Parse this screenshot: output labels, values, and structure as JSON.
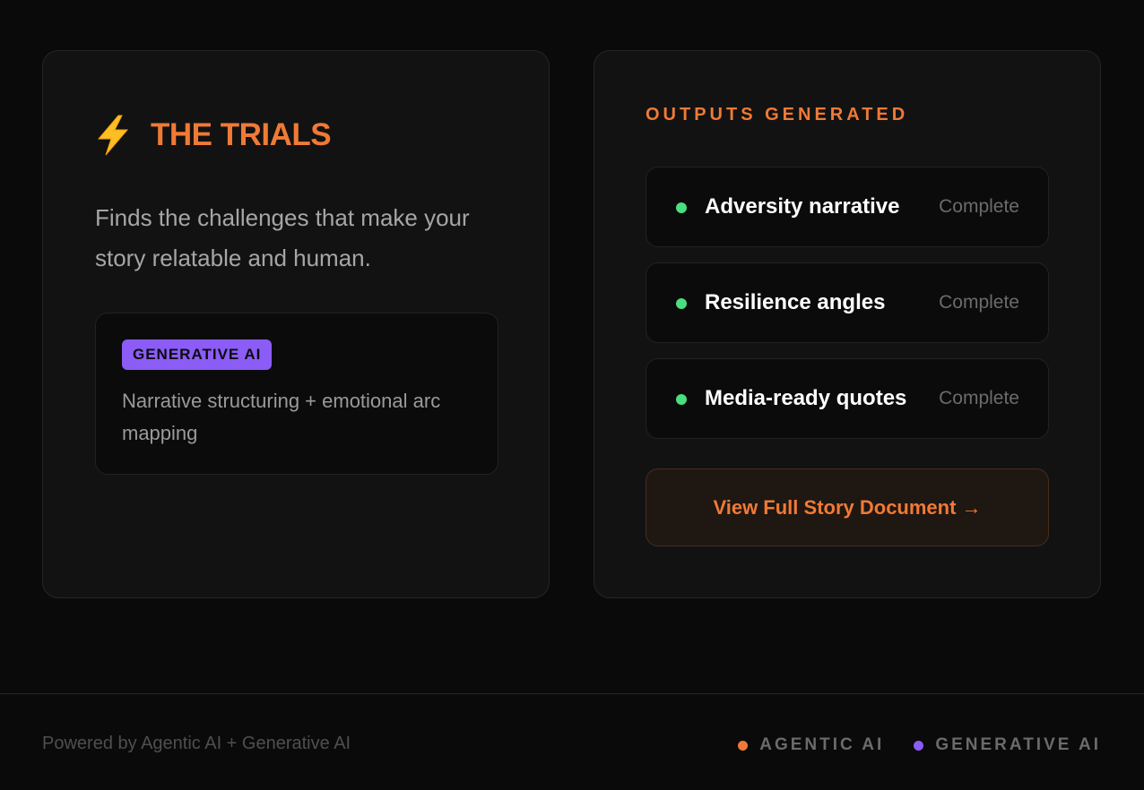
{
  "trials": {
    "icon": "lightning-bolt-icon",
    "title": "THE TRIALS",
    "description": "Finds the challenges that make your story relatable and human.",
    "generative": {
      "badge": "GENERATIVE AI",
      "text": "Narrative structuring + emotional arc mapping"
    }
  },
  "outputs": {
    "title": "OUTPUTS GENERATED",
    "items": [
      {
        "label": "Adversity narrative",
        "status": "Complete"
      },
      {
        "label": "Resilience angles",
        "status": "Complete"
      },
      {
        "label": "Media-ready quotes",
        "status": "Complete"
      }
    ],
    "button": "View Full Story Document →"
  },
  "footer": {
    "powered": "Powered by Agentic AI + Generative AI",
    "legend": [
      {
        "label": "AGENTIC AI",
        "color": "#f07a35"
      },
      {
        "label": "GENERATIVE AI",
        "color": "#8b5cf6"
      }
    ]
  },
  "colors": {
    "accent": "#f07a35",
    "purple": "#8b5cf6",
    "success": "#4ade80",
    "background": "#0a0a0a"
  }
}
